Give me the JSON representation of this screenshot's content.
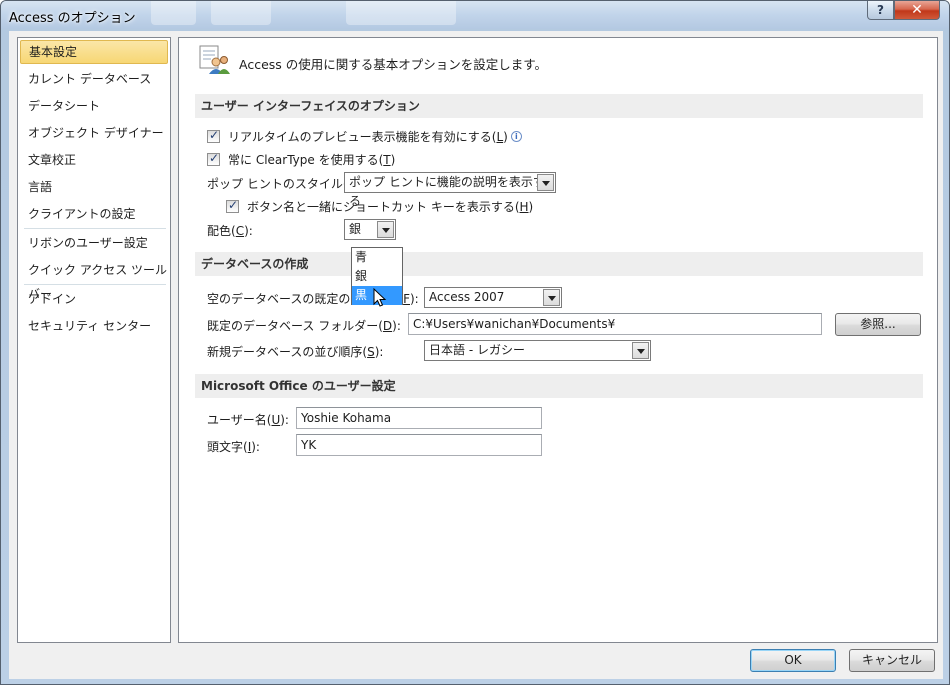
{
  "window": {
    "title": "Access のオプション",
    "help_label": "?",
    "close_label": "✕"
  },
  "sidebar": {
    "items": [
      {
        "label": "基本設定",
        "selected": true
      },
      {
        "label": "カレント データベース"
      },
      {
        "label": "データシート"
      },
      {
        "label": "オブジェクト デザイナー"
      },
      {
        "label": "文章校正"
      },
      {
        "label": "言語"
      },
      {
        "label": "クライアントの設定"
      },
      {
        "label": "リボンのユーザー設定"
      },
      {
        "label": "クイック アクセス ツール バー"
      },
      {
        "label": "アドイン"
      },
      {
        "label": "セキュリティ センター"
      }
    ]
  },
  "header": {
    "text": "Access の使用に関する基本オプションを設定します。",
    "icon": "options-people-icon"
  },
  "ui_section": {
    "title": "ユーザー インターフェイスのオプション",
    "live_preview": {
      "label": "リアルタイムのプレビュー表示機能を有効にする(",
      "key": "L",
      "suffix": ")",
      "checked": true
    },
    "cleartype": {
      "label": "常に ClearType を使用する(",
      "key": "T",
      "suffix": ")",
      "checked": true
    },
    "tooltip_style": {
      "label": "ポップ ヒントのスタイル(",
      "key": "R",
      "suffix": "):",
      "value": "ポップ ヒントに機能の説明を表示する"
    },
    "shortcut_keys": {
      "label": "ボタン名と一緒にショートカット キーを表示する(",
      "key": "H",
      "suffix": ")",
      "checked": true
    },
    "color_scheme": {
      "label": "配色(",
      "key": "C",
      "suffix": "):",
      "value": "銀",
      "options": [
        "青",
        "銀",
        "黒"
      ],
      "highlighted": "黒"
    }
  },
  "db_section": {
    "title": "データベースの作成",
    "default_format": {
      "label": "空のデータベースの既定のファイル(",
      "key": "F",
      "suffix": "):",
      "value": "Access 2007"
    },
    "default_folder": {
      "label": "既定のデータベース フォルダー(",
      "key": "D",
      "suffix": "):",
      "value": "C:¥Users¥wanichan¥Documents¥",
      "browse_label": "参照..."
    },
    "sort_order": {
      "label": "新規データベースの並び順序(",
      "key": "S",
      "suffix": "):",
      "value": "日本語 - レガシー"
    }
  },
  "user_section": {
    "title": "Microsoft Office のユーザー設定",
    "user_name": {
      "label": "ユーザー名(",
      "key": "U",
      "suffix": "):",
      "value": "Yoshie Kohama"
    },
    "initials": {
      "label": "頭文字(",
      "key": "I",
      "suffix": "):",
      "value": "YK"
    }
  },
  "footer": {
    "ok_label": "OK",
    "cancel_label": "キャンセル"
  }
}
